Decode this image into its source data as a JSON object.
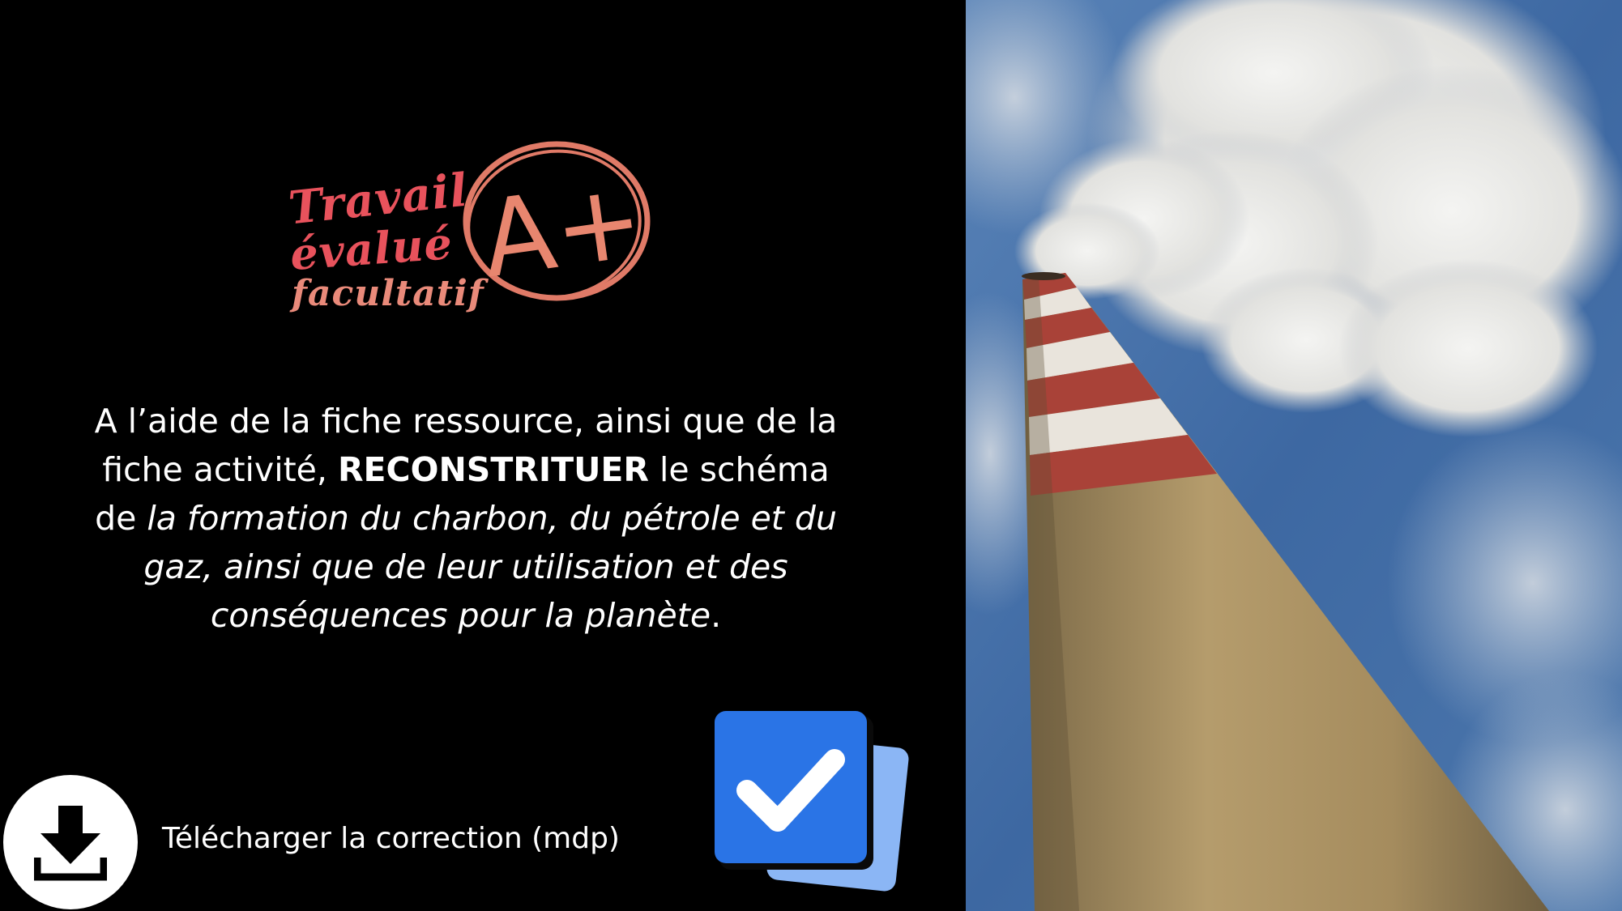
{
  "badge": {
    "line1": "Travail",
    "line2": "évalué",
    "line3": "facultatif",
    "grade": "A+",
    "colors": {
      "primary": "#e8525c",
      "circle": "#e07a67"
    }
  },
  "instruction": {
    "part1": "A l’aide de la fiche ressource, ainsi que de la fiche activité, ",
    "emphasis": "RECONSTRITUER",
    "part2": " le schéma de ",
    "italic": "la formation du charbon, du pétrole et du gaz, ainsi que de leur utilisation et des conséquences pour la planète",
    "end": "."
  },
  "download": {
    "label": "Télécharger la correction (mdp)",
    "icon": "download-icon"
  },
  "correction_icon": {
    "icon": "checkbox-check-icon",
    "colors": {
      "front": "#2a74e6",
      "back": "#8bb6f5",
      "check": "#ffffff"
    }
  },
  "photo": {
    "subject": "chimney-smoke-photo",
    "colors": {
      "sky": "#3f6aa3",
      "stripe_red": "#a94238",
      "stripe_white": "#e9e4dc",
      "concrete": "#a48a5e"
    }
  }
}
